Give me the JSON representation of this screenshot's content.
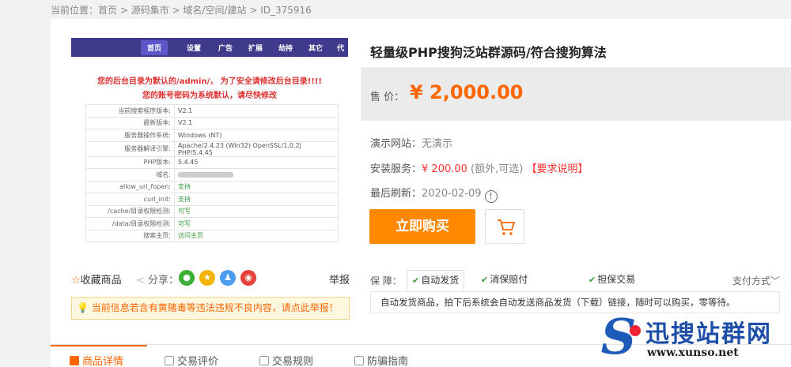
{
  "breadcrumb": {
    "prefix": "当前位置：",
    "items": [
      "首页",
      "源码集市",
      "域名/空间/建站",
      "ID_375916"
    ],
    "sep": " > "
  },
  "preview": {
    "nav": [
      "首页",
      "设置",
      "广告",
      "扩展",
      "劫持",
      "其它",
      "代"
    ],
    "warning1": "您的后台目录为默认的/admin/， 为了安全请修改后台目录!!!!",
    "warning2": "您的账号密码为系统默认，请尽快修改",
    "rows": [
      {
        "k": "当前搜索程序版本:",
        "v": "V2.1"
      },
      {
        "k": "最新版本:",
        "v": "V2.1"
      },
      {
        "k": "服务器操作系统:",
        "v": "Windows (NT)"
      },
      {
        "k": "服务器解译引擎:",
        "v": "Apache/2.4.23 (Win32) OpenSSL/1.0.2j PHP/5.4.45"
      },
      {
        "k": "PHP版本:",
        "v": "5.4.45"
      },
      {
        "k": "域名:",
        "v": ""
      },
      {
        "k": "allow_url_fopen:",
        "v": "支持"
      },
      {
        "k": "curl_init:",
        "v": "支持"
      },
      {
        "k": "/cache/目录权限检测:",
        "v": "可写"
      },
      {
        "k": "/data/目录权限检测:",
        "v": "可写"
      },
      {
        "k": "搜索主页:",
        "v": "访问主页"
      }
    ]
  },
  "actions": {
    "favorite": "收藏商品",
    "share": "分享：",
    "report": "举报"
  },
  "notice": "当前信息若含有黄赌毒等违法违规不良内容，请点此举报！",
  "product": {
    "title": "轻量级PHP搜狗泛站群源码/符合搜狗算法",
    "price_label": "售 价：",
    "price": "¥ 2,000.00",
    "demo_label": "演示网站：",
    "demo_value": "无演示",
    "install_label": "安装服务：",
    "install_price": "¥ 200.00",
    "install_note": "(额外,可选)",
    "install_req": "【要求说明】",
    "refresh_label": "最后刷新：",
    "refresh_value": "2020-02-09",
    "buy": "立即购买"
  },
  "guarantee": {
    "label": "保 障：",
    "tags": [
      "自动发货",
      "消保赔付",
      "担保交易"
    ],
    "pay": "支付方式",
    "desc": "自动发货商品，拍下后系统会自动发送商品发货（下载）链接，随时可以购买，零等待。"
  },
  "tabs": [
    "商品详情",
    "交易评价",
    "交易规则",
    "防骗指南"
  ],
  "watermark": {
    "title": "迅搜站群网",
    "url": "www.xunso.net"
  },
  "colors": {
    "accent": "#ff6600",
    "buy": "#ff8800",
    "nav": "#3f3a8c"
  }
}
